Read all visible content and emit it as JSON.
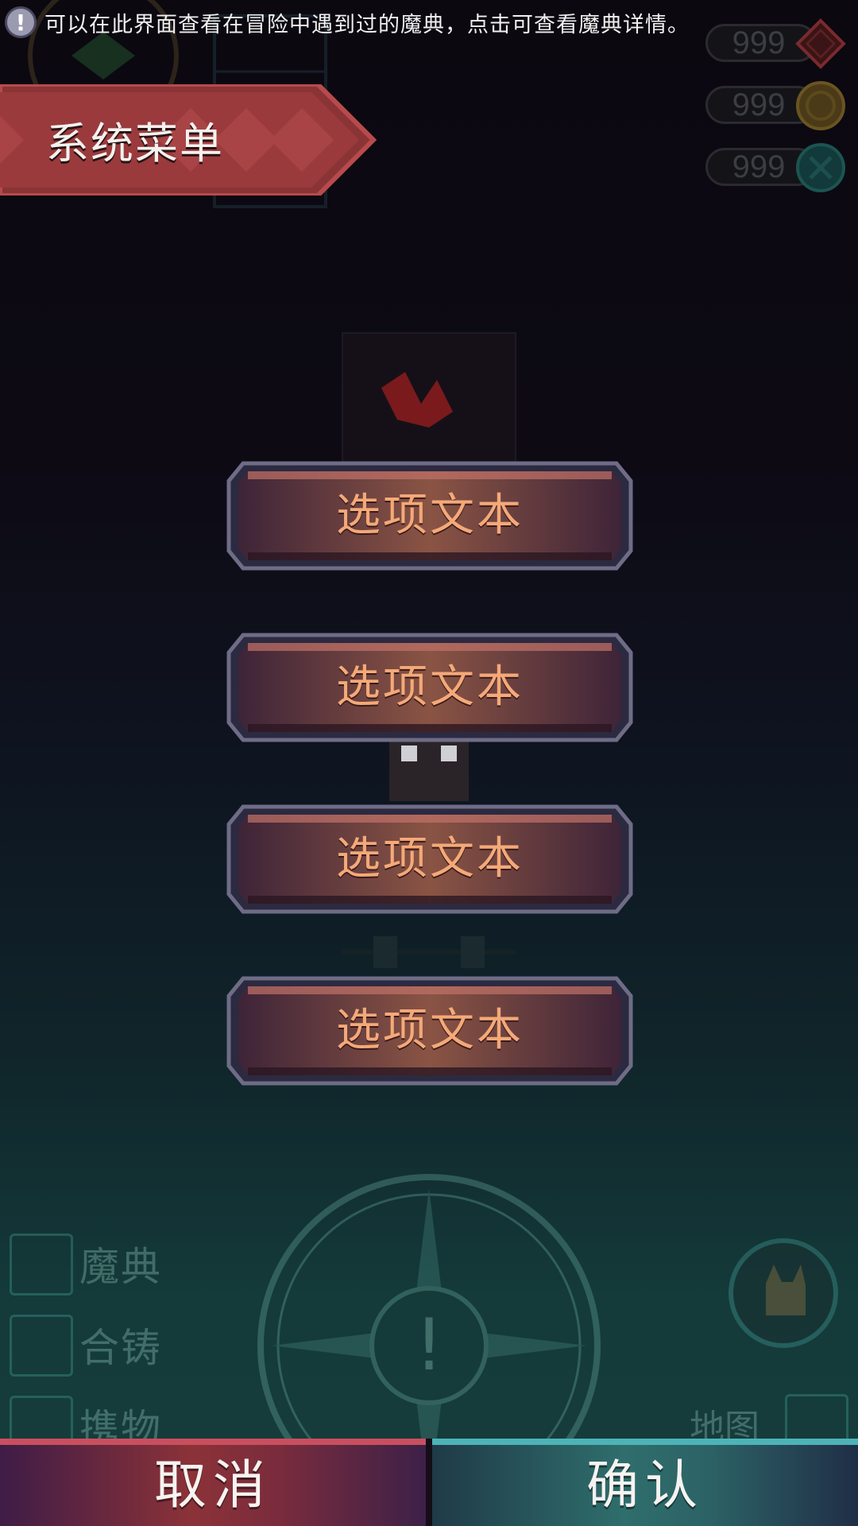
{
  "hint": {
    "icon": "exclamation-info-icon",
    "glyph": "!",
    "text": "可以在此界面查看在冒险中遇到过的魔典，点击可查看魔典详情。"
  },
  "currencies": [
    {
      "value": "999",
      "icon": "red-diamond-gem-icon",
      "color": "#c0393b"
    },
    {
      "value": "999",
      "icon": "gold-coin-icon",
      "color": "#c9953a"
    },
    {
      "value": "999",
      "icon": "teal-orb-icon",
      "color": "#2a8c86"
    }
  ],
  "title": "系统菜单",
  "options": [
    {
      "label": "选项文本"
    },
    {
      "label": "选项文本"
    },
    {
      "label": "选项文本"
    },
    {
      "label": "选项文本"
    }
  ],
  "side_menu": [
    {
      "label": "魔典",
      "icon": "grimoire-book-icon"
    },
    {
      "label": "合铸",
      "icon": "forge-icon"
    },
    {
      "label": "携物",
      "icon": "relic-icon"
    }
  ],
  "map_label": "地图",
  "compass_center_glyph": "!",
  "bottom_bar": {
    "cancel_label": "取消",
    "confirm_label": "确认"
  },
  "colors": {
    "option_text": "#f4a978",
    "cancel_accent": "#c94f5f",
    "confirm_accent": "#4db3b7"
  }
}
